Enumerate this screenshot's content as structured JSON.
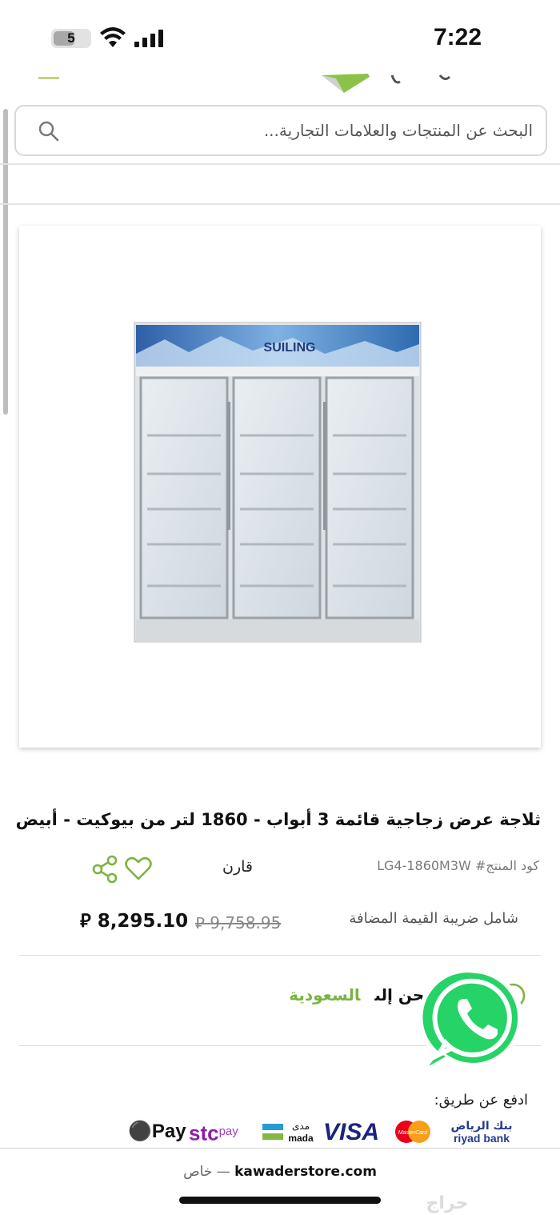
{
  "status_bar": {
    "time": "7:22",
    "battery_level": "5"
  },
  "search": {
    "placeholder": "البحث عن المنتجات والعلامات التجارية..."
  },
  "product": {
    "title": "ثلاجة عرض زجاجية قائمة 3 أبواب - 1860 لتر من بيوكيت - أبيض",
    "image_brand_text": "SUILING",
    "sku_label": "كود المنتج# LG4-1860M3W",
    "compare_label": "قارن",
    "vat_note": "شامل ضريبة القيمة المضافة",
    "old_price": "9,758.95",
    "price": "8,295.10",
    "currency_symbol": "⃁"
  },
  "shipping": {
    "text": "نحن نشحن إلى",
    "country": "السعودية"
  },
  "payment": {
    "label": "ادفع عن طريق:",
    "methods": {
      "apple_pay": "Pay",
      "stc": "stc",
      "stc_pay": "pay",
      "mada_ar": "مدى",
      "mada_en": "mada",
      "visa": "VISA",
      "mastercard": "MasterCard",
      "riyad_ar": "بنك الرياض",
      "riyad_en": "riyad bank"
    }
  },
  "footer": {
    "private_label": "خاص —",
    "domain": "kawaderstore.com",
    "watermark": "حراج"
  },
  "colors": {
    "accent_green": "#7cb342",
    "whatsapp_green": "#25d366"
  }
}
